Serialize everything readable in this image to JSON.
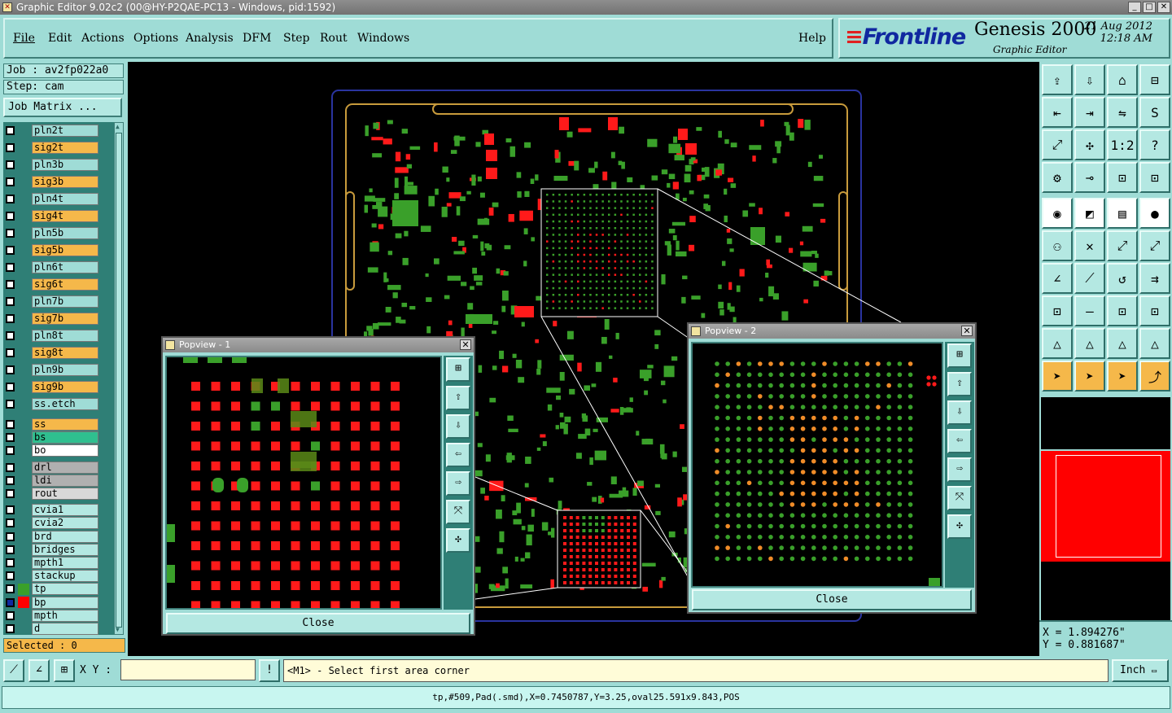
{
  "window": {
    "title": "Graphic Editor 9.02c2 (00@HY-P2QAE-PC13 - Windows, pid:1592)"
  },
  "menu": [
    "File",
    "Edit",
    "Actions",
    "Options",
    "Analysis",
    "DFM",
    "Step",
    "Rout",
    "Windows"
  ],
  "help": "Help",
  "brand": {
    "logo": "Frontline",
    "product": "Genesis 2000",
    "subtitle": "Graphic Editor",
    "date": "21 Aug 2012",
    "time": "12:18 AM"
  },
  "job": {
    "job_label": "Job : av2fp022a0",
    "step_label": "Step: cam",
    "matrix_button": "Job Matrix ..."
  },
  "layers": [
    {
      "name": "pln2t",
      "color": "#9fdcd6"
    },
    {
      "name": "sig2t",
      "color": "#f5b84a"
    },
    {
      "name": "pln3b",
      "color": "#9fdcd6"
    },
    {
      "name": "sig3b",
      "color": "#f5b84a"
    },
    {
      "name": "pln4t",
      "color": "#9fdcd6"
    },
    {
      "name": "sig4t",
      "color": "#f5b84a"
    },
    {
      "name": "pln5b",
      "color": "#9fdcd6"
    },
    {
      "name": "sig5b",
      "color": "#f5b84a"
    },
    {
      "name": "pln6t",
      "color": "#9fdcd6"
    },
    {
      "name": "sig6t",
      "color": "#f5b84a"
    },
    {
      "name": "pln7b",
      "color": "#9fdcd6"
    },
    {
      "name": "sig7b",
      "color": "#f5b84a"
    },
    {
      "name": "pln8t",
      "color": "#9fdcd6"
    },
    {
      "name": "sig8t",
      "color": "#f5b84a"
    },
    {
      "name": "pln9b",
      "color": "#9fdcd6"
    },
    {
      "name": "sig9b",
      "color": "#f5b84a"
    },
    {
      "name": "ss.etch",
      "color": "#9fdcd6"
    },
    {
      "name": "ss",
      "color": "#f5b84a"
    },
    {
      "name": "bs",
      "color": "#2fbf8f"
    },
    {
      "name": "bo",
      "color": "#ffffff"
    },
    {
      "name": "drl",
      "color": "#b0b0b0"
    },
    {
      "name": "ldi",
      "color": "#b0b0b0"
    },
    {
      "name": "rout",
      "color": "#d8d8d8"
    },
    {
      "name": "cvia1",
      "color": "#b4e8e2"
    },
    {
      "name": "cvia2",
      "color": "#b4e8e2"
    },
    {
      "name": "brd",
      "color": "#b4e8e2"
    },
    {
      "name": "bridges",
      "color": "#b4e8e2"
    },
    {
      "name": "mpth1",
      "color": "#b4e8e2"
    },
    {
      "name": "stackup",
      "color": "#b4e8e2"
    },
    {
      "name": "tp",
      "color": "#b4e8e2",
      "swatch": "#3aa02a"
    },
    {
      "name": "bp",
      "color": "#b4e8e2",
      "swatch": "#ff0000"
    },
    {
      "name": "mpth",
      "color": "#b4e8e2"
    },
    {
      "name": "d",
      "color": "#b4e8e2"
    }
  ],
  "selected": "Selected : 0",
  "popview1": {
    "title": "Popview - 1",
    "close": "Close"
  },
  "popview2": {
    "title": "Popview - 2",
    "close": "Close"
  },
  "coords": {
    "x": "X = 1.894276\"",
    "y": "Y = 0.881687\""
  },
  "xy_label": "X Y :",
  "xy_value": "",
  "prompt": "<M1> - Select first area corner",
  "units": "Inch",
  "status": "tp,#509,Pad(.smd),X=0.7450787,Y=3.25,oval25.591x9.843,POS",
  "colors": {
    "pad_red": "#ff1a1a",
    "pad_green": "#3aa02a",
    "pad_orange": "#f08c28",
    "outline": "#c89b3c",
    "board": "#2a34a0"
  }
}
